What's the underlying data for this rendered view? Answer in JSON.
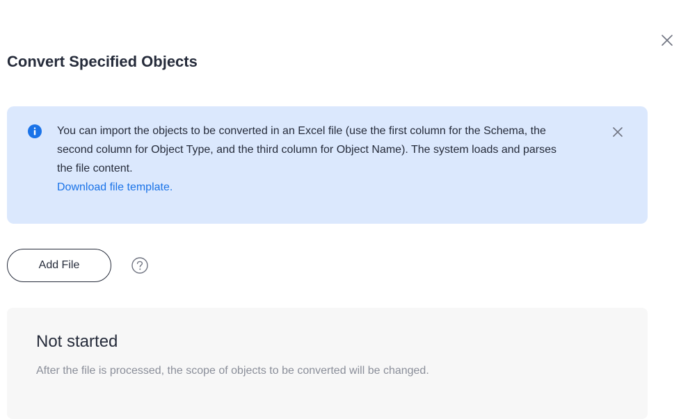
{
  "dialog": {
    "title": "Convert Specified Objects"
  },
  "alert": {
    "message": "You can import the objects to be converted in an Excel file (use the first column for the Schema, the second column for Object Type, and the third column for Object Name). The system loads and parses the file content.",
    "link_label": "Download file template.",
    "info_icon": "info-icon",
    "close_icon": "close-icon"
  },
  "upload": {
    "add_file_label": "Add File",
    "help_icon": "help-icon"
  },
  "status": {
    "title": "Not started",
    "description": "After the file is processed, the scope of objects to be converted will be changed."
  },
  "colors": {
    "alert_background": "#dbe8fd",
    "info_icon": "#1a73e8",
    "link": "#1a73e8",
    "text_primary": "#252b3a",
    "text_secondary": "#8a8e99",
    "panel_background": "#f7f7f7"
  }
}
